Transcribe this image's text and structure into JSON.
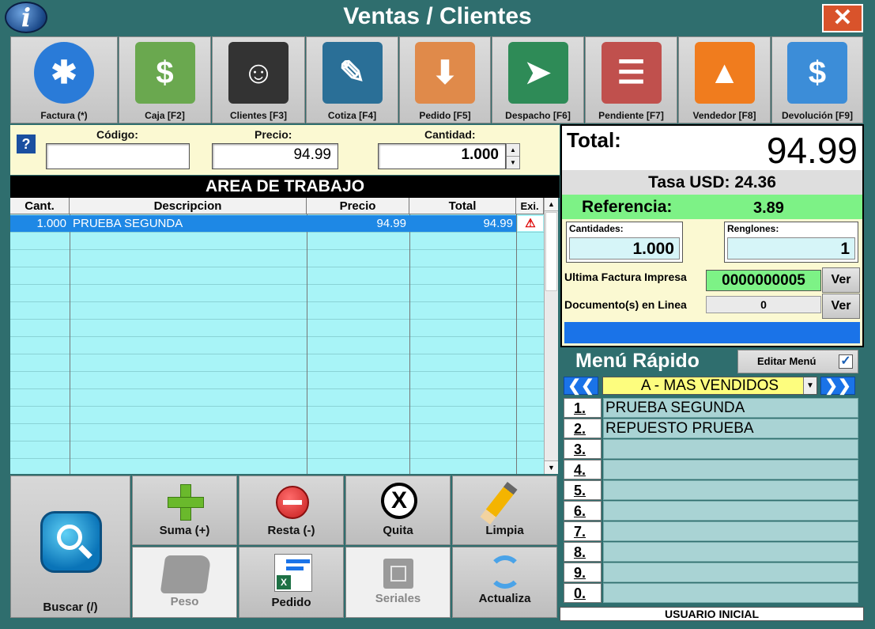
{
  "window": {
    "title": "Ventas / Clientes",
    "logo_letter": "i",
    "close_label": "✕"
  },
  "toolbar": [
    {
      "label": "Factura (*)",
      "icon": "medical-star-icon",
      "color": "#2a7bd8"
    },
    {
      "label": "Caja [F2]",
      "icon": "money-hand-icon",
      "color": "#6aa84f"
    },
    {
      "label": "Clientes [F3]",
      "icon": "client-person-icon",
      "color": "#333333"
    },
    {
      "label": "Cotiza [F4]",
      "icon": "quote-pen-icon",
      "color": "#2a6f97"
    },
    {
      "label": "Pedido [F5]",
      "icon": "order-box-icon",
      "color": "#e08a4a"
    },
    {
      "label": "Despacho [F6]",
      "icon": "delivery-scooter-icon",
      "color": "#2e8b57"
    },
    {
      "label": "Pendiente [F7]",
      "icon": "pending-document-icon",
      "color": "#c0504d"
    },
    {
      "label": "Vendedor [F8]",
      "icon": "seller-chart-icon",
      "color": "#f07c1e"
    },
    {
      "label": "Devolución [F9]",
      "icon": "refund-hand-icon",
      "color": "#3c8dd8"
    }
  ],
  "input": {
    "help": "?",
    "codigo_label": "Código:",
    "codigo_value": "",
    "precio_label": "Precio:",
    "precio_value": "94.99",
    "cantidad_label": "Cantidad:",
    "cantidad_value": "1.000"
  },
  "grid": {
    "title": "AREA DE TRABAJO",
    "columns": [
      "Cant.",
      "Descripcion",
      "Precio",
      "Total",
      "Exi."
    ],
    "rows": [
      {
        "cant": "1.000",
        "descripcion": "PRUEBA SEGUNDA",
        "precio": "94.99",
        "total": "94.99"
      }
    ]
  },
  "actions": {
    "suma": "Suma (+)",
    "resta": "Resta (-)",
    "quita": "Quita",
    "limpia": "Limpia",
    "buscar": "Buscar (/)",
    "peso": "Peso",
    "pedido": "Pedido",
    "seriales": "Seriales",
    "actualiza": "Actualiza"
  },
  "summary": {
    "total_label": "Total:",
    "total_value": "94.99",
    "tasa": "Tasa USD: 24.36",
    "referencia_label": "Referencia:",
    "referencia_value": "3.89",
    "cantidades_label": "Cantidades:",
    "cantidades_value": "1.000",
    "renglones_label": "Renglones:",
    "renglones_value": "1",
    "ultima_label": "Ultima Factura Impresa",
    "ultima_value": "0000000005",
    "docs_label": "Documento(s) en Linea",
    "docs_value": "0",
    "ver": "Ver"
  },
  "quick_menu": {
    "title": "Menú Rápido",
    "edit_label": "Editar Menú",
    "edit_checked": true,
    "prev": "❮❮",
    "next": "❯❯",
    "category": "A - MAS VENDIDOS",
    "items": [
      {
        "num": "1.",
        "name": "PRUEBA SEGUNDA"
      },
      {
        "num": "2.",
        "name": "REPUESTO PRUEBA"
      },
      {
        "num": "3.",
        "name": ""
      },
      {
        "num": "4.",
        "name": ""
      },
      {
        "num": "5.",
        "name": ""
      },
      {
        "num": "6.",
        "name": ""
      },
      {
        "num": "7.",
        "name": ""
      },
      {
        "num": "8.",
        "name": ""
      },
      {
        "num": "9.",
        "name": ""
      },
      {
        "num": "0.",
        "name": ""
      }
    ]
  },
  "status": {
    "user": "USUARIO INICIAL"
  }
}
